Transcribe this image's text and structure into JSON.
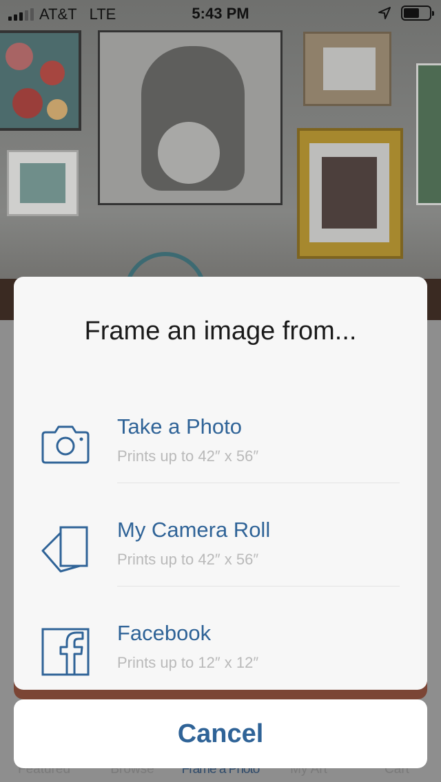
{
  "status_bar": {
    "carrier": "AT&T",
    "network": "LTE",
    "time": "5:43 PM"
  },
  "sheet": {
    "title": "Frame an image from...",
    "options": [
      {
        "label": "Take a Photo",
        "subtitle": "Prints up to 42″ x 56″",
        "icon": "camera-icon"
      },
      {
        "label": "My Camera Roll",
        "subtitle": "Prints up to 42″ x 56″",
        "icon": "photos-stack-icon"
      },
      {
        "label": "Facebook",
        "subtitle": "Prints up to 12″ x 12″",
        "icon": "facebook-icon"
      }
    ]
  },
  "cancel_label": "Cancel",
  "tab_bar": {
    "items": [
      "Featured",
      "Browse",
      "Frame a Photo",
      "My Art",
      "Cart"
    ],
    "active": "Frame a Photo"
  },
  "colors": {
    "accent": "#2f6397",
    "sheet_bg": "#f7f7f7",
    "subtitle": "#b9b9b9"
  }
}
